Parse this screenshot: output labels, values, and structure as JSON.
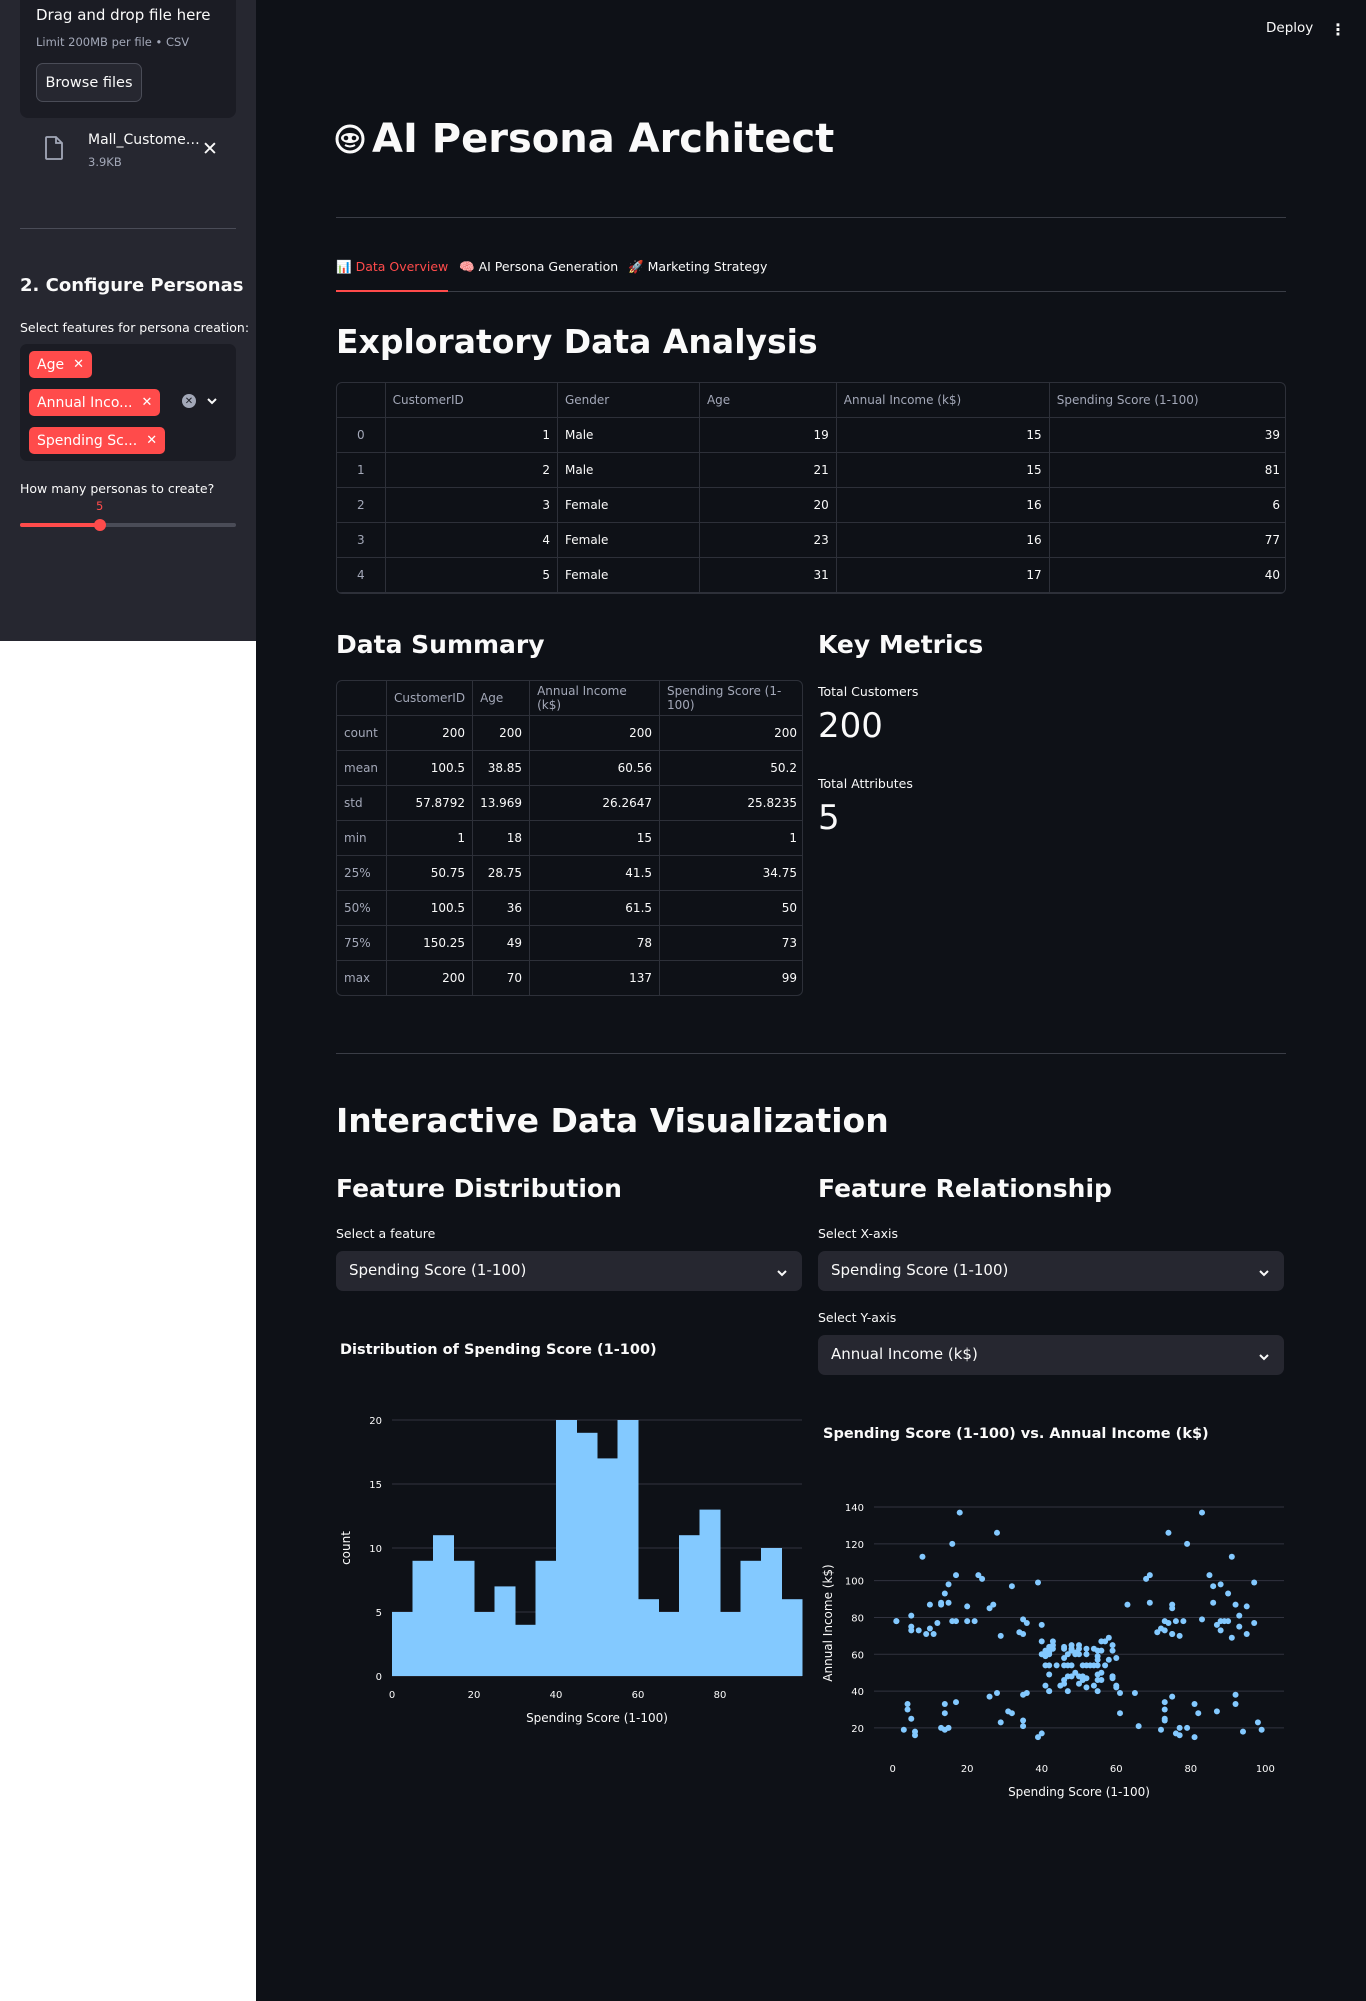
{
  "sidebar": {
    "uploader": {
      "title": "Drag and drop file here",
      "limit": "Limit 200MB per file • CSV",
      "browse_label": "Browse files"
    },
    "file": {
      "name": "Mall_Customers.csv",
      "size": "3.9KB",
      "icon": "file-icon"
    },
    "configure_heading": "2. Configure Personas",
    "features_label": "Select features for persona creation:",
    "features": [
      "Age",
      "Annual Income (k$)",
      "Spending Score (1-100)"
    ],
    "features_display": [
      "Age",
      "Annual Inco...",
      "Spending Sc..."
    ],
    "personas_label": "How many personas to create?",
    "personas_value": "5",
    "personas_min": 2,
    "personas_max": 10,
    "personas_fraction": 0.38
  },
  "header": {
    "deploy_label": "Deploy",
    "menu_icon": "kebab-icon"
  },
  "app_title": "AI Persona Architect",
  "tabs": [
    {
      "icon": "📊",
      "label": "Data Overview",
      "active": true
    },
    {
      "icon": "🧠",
      "label": "AI Persona Generation",
      "active": false
    },
    {
      "icon": "🚀",
      "label": "Marketing Strategy",
      "active": false
    }
  ],
  "eda": {
    "heading": "Exploratory Data Analysis",
    "columns": [
      "",
      "CustomerID",
      "Gender",
      "Age",
      "Annual Income (k$)",
      "Spending Score (1-100)"
    ],
    "rows": [
      [
        "0",
        "1",
        "Male",
        "19",
        "15",
        "39"
      ],
      [
        "1",
        "2",
        "Male",
        "21",
        "15",
        "81"
      ],
      [
        "2",
        "3",
        "Female",
        "20",
        "16",
        "6"
      ],
      [
        "3",
        "4",
        "Female",
        "23",
        "16",
        "77"
      ],
      [
        "4",
        "5",
        "Female",
        "31",
        "17",
        "40"
      ]
    ]
  },
  "summary": {
    "heading": "Data Summary",
    "columns": [
      "",
      "CustomerID",
      "Age",
      "Annual Income (k$)",
      "Spending Score (1-100)"
    ],
    "rows": [
      [
        "count",
        "200",
        "200",
        "200",
        "200"
      ],
      [
        "mean",
        "100.5",
        "38.85",
        "60.56",
        "50.2"
      ],
      [
        "std",
        "57.8792",
        "13.969",
        "26.2647",
        "25.8235"
      ],
      [
        "min",
        "1",
        "18",
        "15",
        "1"
      ],
      [
        "25%",
        "50.75",
        "28.75",
        "41.5",
        "34.75"
      ],
      [
        "50%",
        "100.5",
        "36",
        "61.5",
        "50"
      ],
      [
        "75%",
        "150.25",
        "49",
        "78",
        "73"
      ],
      [
        "max",
        "200",
        "70",
        "137",
        "99"
      ]
    ]
  },
  "metrics": {
    "heading": "Key Metrics",
    "items": [
      {
        "label": "Total Customers",
        "value": "200"
      },
      {
        "label": "Total Attributes",
        "value": "5"
      }
    ]
  },
  "viz": {
    "heading": "Interactive Data Visualization",
    "distribution": {
      "heading": "Feature Distribution",
      "select_label": "Select a feature",
      "selected": "Spending Score (1-100)"
    },
    "relationship": {
      "heading": "Feature Relationship",
      "x_label": "Select X-axis",
      "x_selected": "Spending Score (1-100)",
      "y_label": "Select Y-axis",
      "y_selected": "Annual Income (k$)"
    }
  },
  "colors": {
    "accent": "#ff4b4b",
    "bar": "#83c9ff",
    "background": "#0e1117",
    "sidebar": "#262730"
  },
  "chart_data": [
    {
      "type": "bar",
      "title": "Distribution of Spending Score (1-100)",
      "xlabel": "Spending Score (1-100)",
      "ylabel": "count",
      "bin_edges": [
        0,
        5,
        10,
        15,
        20,
        25,
        30,
        35,
        40,
        45,
        50,
        55,
        60,
        65,
        70,
        75,
        80,
        85,
        90,
        95,
        100
      ],
      "values": [
        5,
        9,
        11,
        9,
        5,
        7,
        4,
        9,
        20,
        19,
        17,
        20,
        6,
        5,
        11,
        13,
        5,
        9,
        10,
        6
      ],
      "xticks": [
        0,
        20,
        40,
        60,
        80
      ],
      "yticks": [
        0,
        5,
        10,
        15,
        20
      ],
      "xlim": [
        0,
        100
      ],
      "ylim": [
        0,
        20
      ],
      "grid": true
    },
    {
      "type": "scatter",
      "title": "Spending Score (1-100) vs. Annual Income (k$)",
      "xlabel": "Spending Score (1-100)",
      "ylabel": "Annual Income (k$)",
      "xticks": [
        0,
        20,
        40,
        60,
        80,
        100
      ],
      "yticks": [
        20,
        40,
        60,
        80,
        100,
        120,
        140
      ],
      "xlim": [
        -5,
        105
      ],
      "ylim": [
        8,
        146
      ],
      "grid": true,
      "points": [
        [
          39,
          15
        ],
        [
          81,
          15
        ],
        [
          6,
          16
        ],
        [
          77,
          16
        ],
        [
          40,
          17
        ],
        [
          76,
          17
        ],
        [
          6,
          18
        ],
        [
          94,
          18
        ],
        [
          3,
          19
        ],
        [
          72,
          19
        ],
        [
          14,
          19
        ],
        [
          99,
          19
        ],
        [
          15,
          20
        ],
        [
          77,
          20
        ],
        [
          13,
          20
        ],
        [
          79,
          20
        ],
        [
          35,
          21
        ],
        [
          66,
          21
        ],
        [
          29,
          23
        ],
        [
          98,
          23
        ],
        [
          35,
          24
        ],
        [
          73,
          24
        ],
        [
          5,
          25
        ],
        [
          73,
          25
        ],
        [
          14,
          28
        ],
        [
          82,
          28
        ],
        [
          32,
          28
        ],
        [
          61,
          28
        ],
        [
          31,
          29
        ],
        [
          87,
          29
        ],
        [
          4,
          30
        ],
        [
          73,
          30
        ],
        [
          4,
          33
        ],
        [
          92,
          33
        ],
        [
          14,
          33
        ],
        [
          81,
          33
        ],
        [
          17,
          34
        ],
        [
          73,
          34
        ],
        [
          26,
          37
        ],
        [
          75,
          37
        ],
        [
          35,
          38
        ],
        [
          92,
          38
        ],
        [
          36,
          39
        ],
        [
          61,
          39
        ],
        [
          28,
          39
        ],
        [
          65,
          39
        ],
        [
          55,
          40
        ],
        [
          47,
          40
        ],
        [
          42,
          40
        ],
        [
          42,
          40
        ],
        [
          52,
          42
        ],
        [
          60,
          42
        ],
        [
          54,
          43
        ],
        [
          60,
          43
        ],
        [
          45,
          43
        ],
        [
          41,
          43
        ],
        [
          50,
          44
        ],
        [
          46,
          44
        ],
        [
          51,
          46
        ],
        [
          46,
          46
        ],
        [
          56,
          46
        ],
        [
          55,
          46
        ],
        [
          52,
          47
        ],
        [
          59,
          47
        ],
        [
          51,
          48
        ],
        [
          59,
          48
        ],
        [
          50,
          48
        ],
        [
          48,
          48
        ],
        [
          59,
          48
        ],
        [
          47,
          48
        ],
        [
          55,
          49
        ],
        [
          42,
          49
        ],
        [
          49,
          50
        ],
        [
          56,
          50
        ],
        [
          47,
          54
        ],
        [
          54,
          54
        ],
        [
          53,
          54
        ],
        [
          48,
          54
        ],
        [
          52,
          54
        ],
        [
          42,
          54
        ],
        [
          51,
          54
        ],
        [
          55,
          54
        ],
        [
          41,
          54
        ],
        [
          44,
          54
        ],
        [
          57,
          54
        ],
        [
          46,
          54
        ],
        [
          58,
          57
        ],
        [
          55,
          57
        ],
        [
          60,
          58
        ],
        [
          46,
          58
        ],
        [
          55,
          59
        ],
        [
          41,
          59
        ],
        [
          49,
          60
        ],
        [
          40,
          60
        ],
        [
          42,
          60
        ],
        [
          52,
          60
        ],
        [
          47,
          60
        ],
        [
          50,
          60
        ],
        [
          42,
          61
        ],
        [
          49,
          61
        ],
        [
          41,
          62
        ],
        [
          48,
          62
        ],
        [
          59,
          62
        ],
        [
          55,
          62
        ],
        [
          56,
          62
        ],
        [
          42,
          62
        ],
        [
          50,
          63
        ],
        [
          46,
          63
        ],
        [
          43,
          63
        ],
        [
          48,
          63
        ],
        [
          52,
          63
        ],
        [
          54,
          63
        ],
        [
          42,
          64
        ],
        [
          46,
          64
        ],
        [
          48,
          65
        ],
        [
          50,
          65
        ],
        [
          43,
          65
        ],
        [
          59,
          65
        ],
        [
          43,
          67
        ],
        [
          57,
          67
        ],
        [
          56,
          67
        ],
        [
          40,
          67
        ],
        [
          58,
          69
        ],
        [
          91,
          69
        ],
        [
          29,
          70
        ],
        [
          77,
          70
        ],
        [
          35,
          71
        ],
        [
          95,
          71
        ],
        [
          11,
          71
        ],
        [
          75,
          71
        ],
        [
          9,
          71
        ],
        [
          75,
          71
        ],
        [
          34,
          72
        ],
        [
          71,
          72
        ],
        [
          5,
          73
        ],
        [
          88,
          73
        ],
        [
          7,
          73
        ],
        [
          73,
          73
        ],
        [
          10,
          74
        ],
        [
          72,
          74
        ],
        [
          5,
          75
        ],
        [
          93,
          75
        ],
        [
          40,
          76
        ],
        [
          87,
          76
        ],
        [
          12,
          77
        ],
        [
          97,
          77
        ],
        [
          36,
          77
        ],
        [
          74,
          77
        ],
        [
          22,
          78
        ],
        [
          90,
          78
        ],
        [
          17,
          78
        ],
        [
          88,
          78
        ],
        [
          20,
          78
        ],
        [
          76,
          78
        ],
        [
          16,
          78
        ],
        [
          89,
          78
        ],
        [
          1,
          78
        ],
        [
          78,
          78
        ],
        [
          1,
          78
        ],
        [
          73,
          78
        ],
        [
          35,
          79
        ],
        [
          83,
          79
        ],
        [
          5,
          81
        ],
        [
          93,
          81
        ],
        [
          26,
          85
        ],
        [
          75,
          85
        ],
        [
          20,
          86
        ],
        [
          95,
          86
        ],
        [
          27,
          87
        ],
        [
          63,
          87
        ],
        [
          13,
          87
        ],
        [
          75,
          87
        ],
        [
          10,
          87
        ],
        [
          92,
          87
        ],
        [
          13,
          88
        ],
        [
          86,
          88
        ],
        [
          15,
          88
        ],
        [
          69,
          88
        ],
        [
          14,
          93
        ],
        [
          90,
          93
        ],
        [
          32,
          97
        ],
        [
          86,
          97
        ],
        [
          15,
          98
        ],
        [
          88,
          98
        ],
        [
          39,
          99
        ],
        [
          97,
          99
        ],
        [
          24,
          101
        ],
        [
          68,
          101
        ],
        [
          17,
          103
        ],
        [
          85,
          103
        ],
        [
          23,
          103
        ],
        [
          69,
          103
        ],
        [
          8,
          113
        ],
        [
          91,
          113
        ],
        [
          16,
          120
        ],
        [
          79,
          120
        ],
        [
          28,
          126
        ],
        [
          74,
          126
        ],
        [
          18,
          137
        ],
        [
          83,
          137
        ]
      ]
    }
  ]
}
